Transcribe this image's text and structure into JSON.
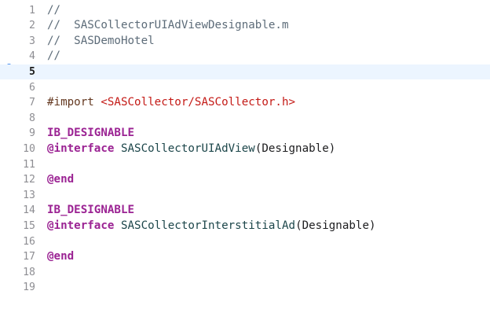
{
  "editor": {
    "current_line_index": 4,
    "lines": [
      {
        "number": "1",
        "tokens": [
          {
            "t": "comment",
            "v": "//"
          }
        ]
      },
      {
        "number": "2",
        "tokens": [
          {
            "t": "comment",
            "v": "//  SASCollectorUIAdViewDesignable.m"
          }
        ]
      },
      {
        "number": "3",
        "tokens": [
          {
            "t": "comment",
            "v": "//  SASDemoHotel"
          }
        ]
      },
      {
        "number": "4",
        "tokens": [
          {
            "t": "comment",
            "v": "//"
          }
        ]
      },
      {
        "number": "5",
        "tokens": []
      },
      {
        "number": "6",
        "tokens": []
      },
      {
        "number": "7",
        "tokens": [
          {
            "t": "preproc",
            "v": "#import "
          },
          {
            "t": "string",
            "v": "<SASCollector/SASCollector.h>"
          }
        ]
      },
      {
        "number": "8",
        "tokens": []
      },
      {
        "number": "9",
        "tokens": [
          {
            "t": "keyword",
            "v": "IB_DESIGNABLE"
          }
        ]
      },
      {
        "number": "10",
        "tokens": [
          {
            "t": "keyword",
            "v": "@interface"
          },
          {
            "t": "plain",
            "v": " "
          },
          {
            "t": "type",
            "v": "SASCollectorUIAdView"
          },
          {
            "t": "plain",
            "v": "(Designable)"
          }
        ]
      },
      {
        "number": "11",
        "tokens": []
      },
      {
        "number": "12",
        "tokens": [
          {
            "t": "keyword",
            "v": "@end"
          }
        ]
      },
      {
        "number": "13",
        "tokens": []
      },
      {
        "number": "14",
        "tokens": [
          {
            "t": "keyword",
            "v": "IB_DESIGNABLE"
          }
        ]
      },
      {
        "number": "15",
        "tokens": [
          {
            "t": "keyword",
            "v": "@interface"
          },
          {
            "t": "plain",
            "v": " "
          },
          {
            "t": "type",
            "v": "SASCollectorInterstitialAd"
          },
          {
            "t": "plain",
            "v": "(Designable)"
          }
        ]
      },
      {
        "number": "16",
        "tokens": []
      },
      {
        "number": "17",
        "tokens": [
          {
            "t": "keyword",
            "v": "@end"
          }
        ]
      },
      {
        "number": "18",
        "tokens": []
      },
      {
        "number": "19",
        "tokens": []
      }
    ]
  }
}
